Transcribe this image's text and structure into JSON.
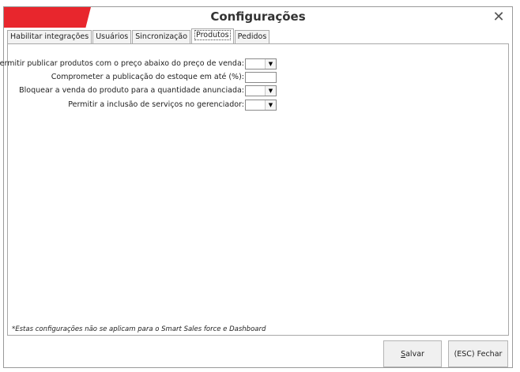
{
  "window": {
    "title": "Configurações",
    "brand_color": "#e8262d",
    "close_icon": "close-icon"
  },
  "tabs": [
    {
      "label": "Habilitar integrações",
      "active": false
    },
    {
      "label": "Usuários",
      "active": false
    },
    {
      "label": "Sincronização",
      "active": false
    },
    {
      "label": "Produtos",
      "active": true
    },
    {
      "label": "Pedidos",
      "active": false
    }
  ],
  "settings": [
    {
      "label": "Permitir publicar produtos com o preço abaixo do preço de venda:",
      "control": "dropdown",
      "value": ""
    },
    {
      "label": "Comprometer a publicação do estoque em até (%):",
      "control": "text",
      "value": ""
    },
    {
      "label": "Bloquear a venda do produto para a quantidade  anunciada:",
      "control": "dropdown",
      "value": ""
    },
    {
      "label": "Permitir a inclusão de serviços no gerenciador:",
      "control": "dropdown",
      "value": ""
    }
  ],
  "footnote": "*Estas configurações não se aplicam para o Smart Sales force e Dashboard",
  "buttons": {
    "save_mnemonic": "S",
    "save_rest": "alvar",
    "close_label": "(ESC) Fechar"
  },
  "dropdown_glyph": "▼"
}
